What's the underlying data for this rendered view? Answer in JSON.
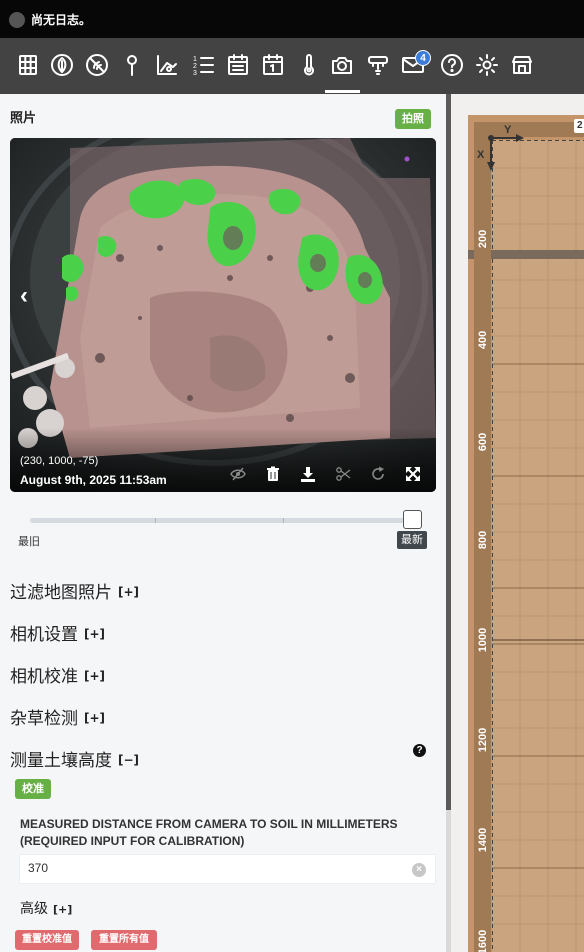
{
  "status_bar": {
    "text": "尚无日志。"
  },
  "nav": {
    "icons": [
      "plants-grid-icon",
      "leaf-icon",
      "weeds-icon",
      "points-icon",
      "zones-icon",
      "sequences-icon",
      "regimens-icon",
      "farmware-events-icon",
      "sensors-icon",
      "photos-icon",
      "tools-icon",
      "messages-icon",
      "help-icon",
      "settings-icon",
      "shop-icon"
    ],
    "message_count": "4"
  },
  "photos_panel": {
    "title": "照片",
    "take_photo_label": "拍照",
    "photo": {
      "coords": "(230, 1000, -75)",
      "date": "August 9th, 2025 11:53am"
    },
    "slider": {
      "min_label": "最旧",
      "max_label": "最新",
      "position": 1.0
    },
    "sections": [
      {
        "label": "过滤地图照片",
        "toggle": "[+]"
      },
      {
        "label": "相机设置",
        "toggle": "[+]"
      },
      {
        "label": "相机校准",
        "toggle": "[+]"
      },
      {
        "label": "杂草检测",
        "toggle": "[+]"
      },
      {
        "label": "测量土壤高度",
        "toggle": "[−]"
      }
    ],
    "soil_height": {
      "calibrate_label": "校准",
      "field_label": "MEASURED DISTANCE FROM CAMERA TO SOIL IN MILLIMETERS (REQUIRED INPUT FOR CALIBRATION)",
      "field_value": "370",
      "advanced_label": "高级",
      "advanced_toggle": "[+]",
      "reset_calibration_label": "重置校准值",
      "reset_all_label": "重置所有值"
    }
  },
  "map": {
    "axis_x": "X",
    "axis_y": "Y",
    "top_label_partial": "2",
    "y_ticks": [
      "200",
      "400",
      "600",
      "800",
      "1000",
      "1200",
      "1400",
      "1600"
    ]
  },
  "colors": {
    "nav_bg": "#434343",
    "accent_green": "#66b046",
    "danger_red": "#e06a6e",
    "bed_brown": "#c4956a"
  }
}
